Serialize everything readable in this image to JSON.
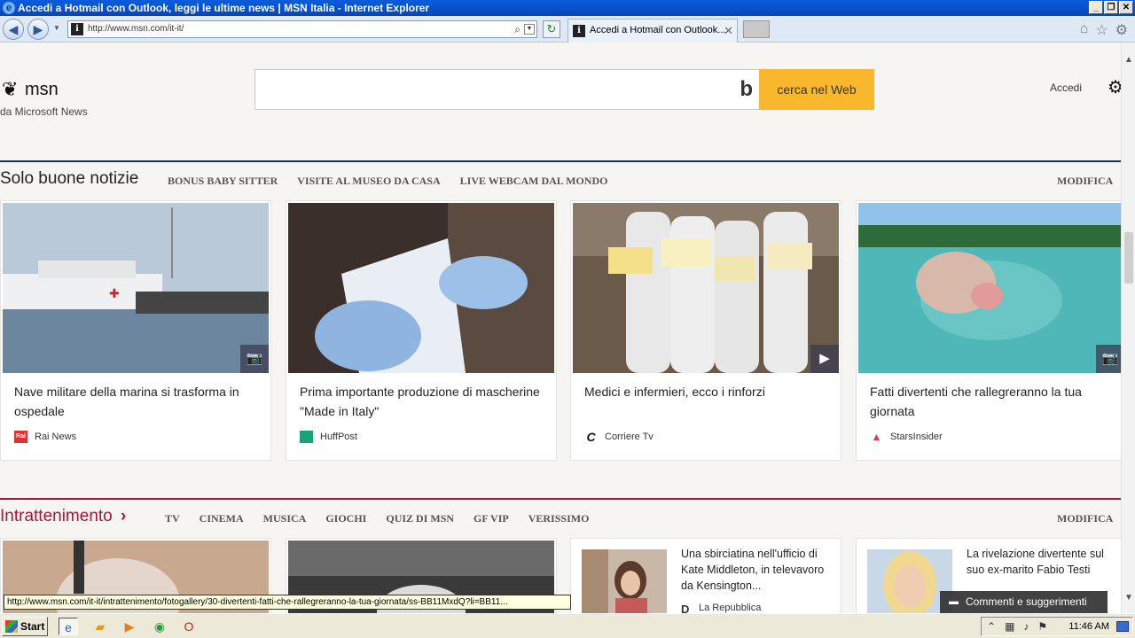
{
  "window": {
    "title": "Accedi a Hotmail con Outlook, leggi le ultime news | MSN Italia - Internet Explorer",
    "address": "http://www.msn.com/it-it/",
    "tab_title": "Accedi a Hotmail con Outlook...",
    "minimize": "_",
    "restore": "❐",
    "close": "✕"
  },
  "header": {
    "logo_text": "msn",
    "subtitle": "da Microsoft News",
    "search_button": "cerca nel Web",
    "signin": "Accedi"
  },
  "section1": {
    "title": "Solo buone notizie",
    "links": [
      "BONUS BABY SITTER",
      "VISITE AL MUSEO DA CASA",
      "LIVE WEBCAM DAL MONDO"
    ],
    "edit": "MODIFICA",
    "rule_color": "#1f2d6b",
    "cards": [
      {
        "title": "Nave militare della marina si trasforma in ospedale",
        "source": "Rai News",
        "src_glyph": "Rai",
        "badge": "camera-icon"
      },
      {
        "title": "Prima importante produzione di mascherine \"Made in Italy\"",
        "source": "HuffPost",
        "src_glyph": "▮▮",
        "badge": ""
      },
      {
        "title": "Medici e infermieri, ecco i rinforzi",
        "source": "Corriere Tv",
        "src_glyph": "C",
        "badge": "play-icon"
      },
      {
        "title": "Fatti divertenti che rallegreranno la tua giornata",
        "source": "StarsInsider",
        "src_glyph": "▲",
        "badge": "camera-icon"
      }
    ]
  },
  "section2": {
    "title": "Intrattenimento",
    "links": [
      "TV",
      "CINEMA",
      "MUSICA",
      "GIOCHI",
      "QUIZ DI MSN",
      "GF VIP",
      "VERISSIMO"
    ],
    "edit": "MODIFICA",
    "rule_color": "#a01a3a",
    "small_cards": [
      {
        "title": "Una sbirciatina nell'ufficio di Kate Middleton, in televavoro da Kensington...",
        "source": "La Repubblica",
        "src_glyph": "D"
      },
      {
        "title": "La rivelazione divertente sul suo ex-marito Fabio Testi",
        "source": "",
        "src_glyph": ""
      }
    ]
  },
  "status_url": "http://www.msn.com/it-it/intrattenimento/fotogallery/30-divertenti-fatti-che-rallegreranno-la-tua-giornata/ss-BB11MxdQ?li=BB11...",
  "feedback": "Commenti e suggerimenti",
  "taskbar": {
    "start": "Start",
    "clock": "11:46 AM"
  },
  "colors": {
    "accent": "#f8b72d",
    "section1_title": "#1f2d6b",
    "section2_title": "#a01a3a"
  }
}
